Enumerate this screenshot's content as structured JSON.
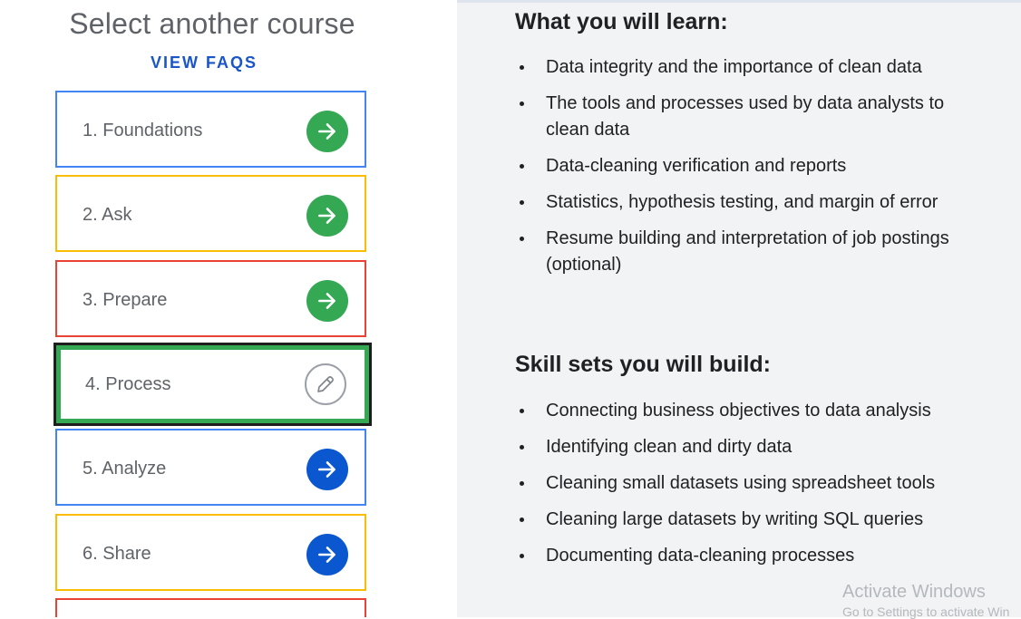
{
  "left": {
    "title": "Select another course",
    "faq_link": "VIEW FAQS",
    "courses": [
      {
        "label": "1. Foundations",
        "border": "#4285f4",
        "state": "complete",
        "icon": "arrow-right-icon",
        "icon_color": "#34a853"
      },
      {
        "label": "2. Ask",
        "border": "#fbbc04",
        "state": "complete",
        "icon": "arrow-right-icon",
        "icon_color": "#34a853"
      },
      {
        "label": "3. Prepare",
        "border": "#ea4335",
        "state": "complete",
        "icon": "arrow-right-icon",
        "icon_color": "#34a853"
      },
      {
        "label": "4. Process",
        "border": "#34a853",
        "state": "current",
        "icon": "pencil-icon",
        "icon_color": "#9aa0a6"
      },
      {
        "label": "5. Analyze",
        "border": "#4285f4",
        "state": "available",
        "icon": "arrow-right-icon",
        "icon_color": "#0b57d0"
      },
      {
        "label": "6. Share",
        "border": "#fbbc04",
        "state": "available",
        "icon": "arrow-right-icon",
        "icon_color": "#0b57d0"
      },
      {
        "label": "",
        "border": "#ea4335",
        "state": "partial",
        "icon": "",
        "icon_color": ""
      }
    ]
  },
  "right": {
    "learn_title": "What you will learn:",
    "learn_items": [
      "Data integrity and the importance of clean data",
      "The tools and processes used by data analysts to clean data",
      "Data-cleaning verification and reports",
      "Statistics, hypothesis testing, and margin of error",
      "Resume building and interpretation of job postings (optional)"
    ],
    "skills_title": "Skill sets you will build:",
    "skills_items": [
      "Connecting business objectives to data analysis",
      "Identifying clean and dirty data",
      "Cleaning small datasets using spreadsheet tools",
      "Cleaning large datasets by writing SQL queries",
      "Documenting data-cleaning processes"
    ]
  },
  "watermark": {
    "line1": "Activate Windows",
    "line2": "Go to Settings to activate Win"
  }
}
